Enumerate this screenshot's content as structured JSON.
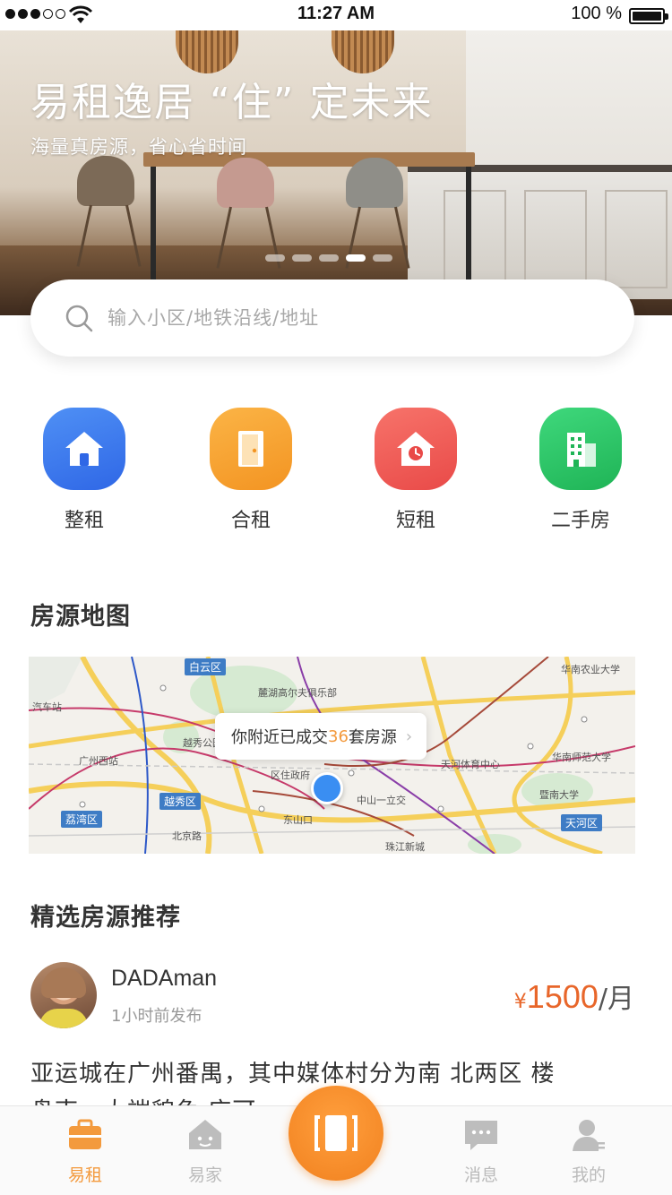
{
  "status_bar": {
    "time": "11:27 AM",
    "battery": "100 %",
    "signal_icon": "signal-icon",
    "wifi_icon": "wifi-icon",
    "battery_icon": "battery-icon"
  },
  "hero": {
    "title": "易租逸居 “住” 定未来",
    "subtitle": "海量真房源，省心省时间",
    "slide_count": 5,
    "active_slide": 4
  },
  "search": {
    "placeholder": "输入小区/地铁沿线/地址",
    "icon": "search-icon"
  },
  "categories": [
    {
      "label": "整租",
      "icon": "house-icon",
      "color": "#3e7ff0"
    },
    {
      "label": "合租",
      "icon": "door-icon",
      "color": "#f6a12f"
    },
    {
      "label": "短租",
      "icon": "clock-house-icon",
      "color": "#f05a56"
    },
    {
      "label": "二手房",
      "icon": "building-icon",
      "color": "#2fc86a"
    }
  ],
  "map_section": {
    "title": "房源地图",
    "bubble_prefix": "你附近已成交",
    "bubble_count": "36",
    "bubble_suffix": "套房源",
    "labels": {
      "baiyun": "白云区",
      "yuexiu": "越秀区",
      "liwan": "荔湾区",
      "tianhe": "天河区",
      "guangzhou_west": "广州西站",
      "huanan_agri": "华南农业大学",
      "huanan_normal": "华南师范大学",
      "jinan": "暨南大学",
      "tianhe_sports": "天河体育中心",
      "dongshankou": "东山口",
      "zhongshanyi": "中山一立交",
      "zhujiang": "珠江新城",
      "beijing_road": "北京路",
      "yuexiu_park": "越秀公园",
      "ludu": "麓湖高尔夫俱乐部",
      "car_station": "汽车站",
      "district_gov": "区住政府"
    }
  },
  "featured": {
    "title": "精选房源推荐",
    "listing": {
      "user": "DADAman",
      "time": "1小时前发布",
      "price_symbol": "¥",
      "price": "1500",
      "price_unit": "/月",
      "description": "亚运城在广州番禺，其中媒体村分为南 北两区 楼",
      "description_line2": "盘南，大端貌兔 应可"
    }
  },
  "tabbar": {
    "items": [
      {
        "label": "易租",
        "icon": "suitcase-icon",
        "active": true
      },
      {
        "label": "易家",
        "icon": "home-face-icon",
        "active": false
      },
      {
        "label": "消息",
        "icon": "message-icon",
        "active": false
      },
      {
        "label": "我的",
        "icon": "user-icon",
        "active": false
      }
    ],
    "center_icon": "scan-icon"
  },
  "colors": {
    "accent": "#f39a3d",
    "price": "#e8662a",
    "map_pin": "#3a8ef2"
  }
}
